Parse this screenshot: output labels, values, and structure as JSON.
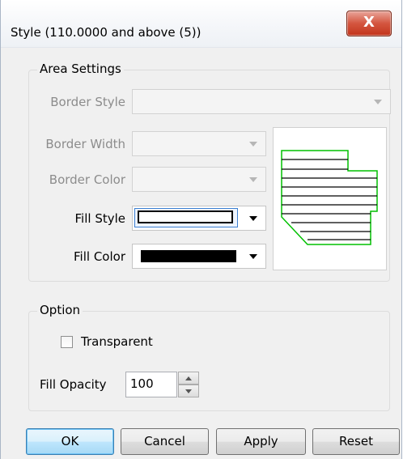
{
  "window": {
    "title": "Style (110.0000 and above (5))",
    "close_glyph": "X"
  },
  "area_settings": {
    "title": "Area Settings",
    "border_style_label": "Border Style",
    "border_width_label": "Border Width",
    "border_color_label": "Border Color",
    "fill_style_label": "Fill Style",
    "fill_color_label": "Fill Color",
    "fill_color_value": "#000000"
  },
  "option": {
    "title": "Option",
    "transparent_label": "Transparent",
    "transparent_checked": false,
    "fill_opacity_label": "Fill Opacity",
    "fill_opacity_value": "100"
  },
  "buttons": {
    "ok": "OK",
    "cancel": "Cancel",
    "apply": "Apply",
    "reset": "Reset"
  },
  "colors": {
    "preview_outline": "#00c000",
    "preview_hatch": "#000000",
    "accent": "#3c7fd1"
  }
}
